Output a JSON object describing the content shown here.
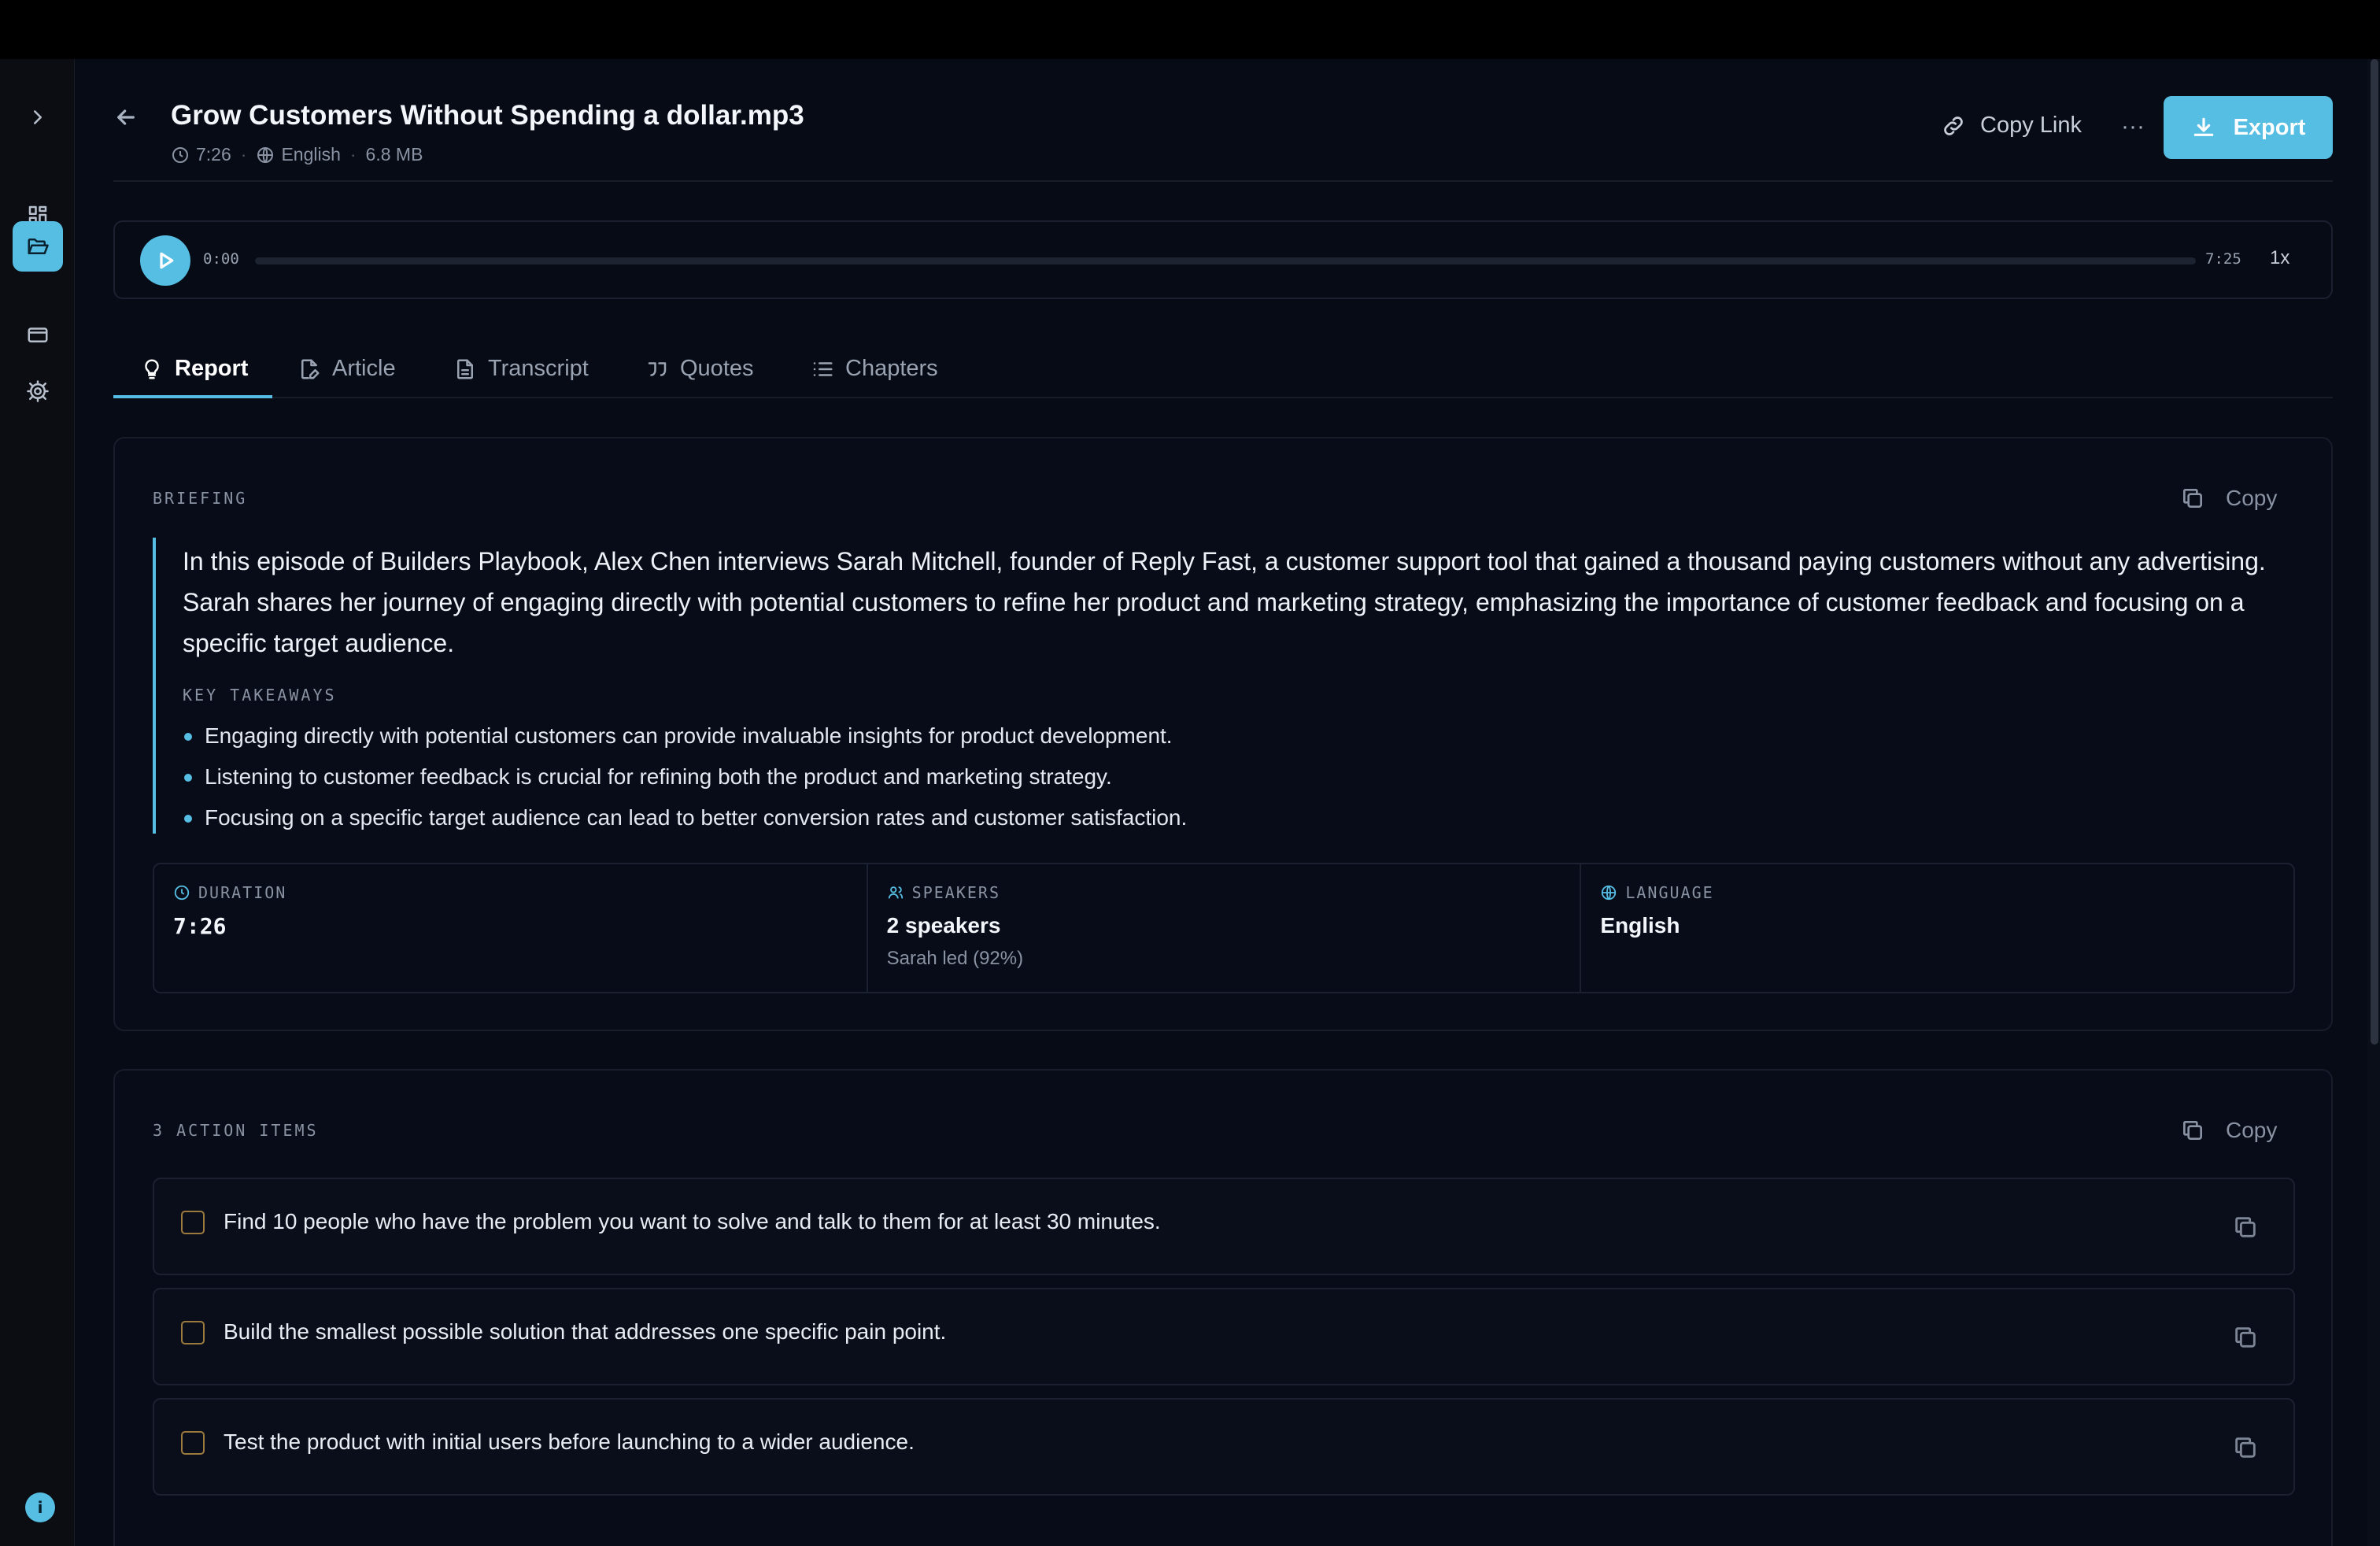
{
  "sidebar": {
    "expand": "chevron-right-icon",
    "items": [
      {
        "name": "dashboard",
        "icon": "grid-icon",
        "active": false
      },
      {
        "name": "library",
        "icon": "folder-open-icon",
        "active": true
      },
      {
        "name": "billing",
        "icon": "credit-card-icon",
        "active": false
      },
      {
        "name": "settings",
        "icon": "gear-icon",
        "active": false
      }
    ],
    "info_badge": "i"
  },
  "header": {
    "title": "Grow Customers Without Spending a dollar.mp3",
    "duration": "7:26",
    "language": "English",
    "size": "6.8 MB",
    "separator": "·",
    "copy_link_label": "Copy Link",
    "more_label": "···",
    "export_label": "Export"
  },
  "player": {
    "current_time": "0:00",
    "total_time": "7:25",
    "progress": 0,
    "speed": "1x"
  },
  "tabs": [
    {
      "label": "Report",
      "icon": "lightbulb-icon",
      "active": true
    },
    {
      "label": "Article",
      "icon": "file-pen-icon",
      "active": false
    },
    {
      "label": "Transcript",
      "icon": "document-icon",
      "active": false
    },
    {
      "label": "Quotes",
      "icon": "quote-icon",
      "active": false
    },
    {
      "label": "Chapters",
      "icon": "list-icon",
      "active": false
    }
  ],
  "briefing": {
    "label": "BRIEFING",
    "copy_label": "Copy",
    "text": "In this episode of Builders Playbook, Alex Chen interviews Sarah Mitchell, founder of Reply Fast, a customer support tool that gained a thousand paying customers without any advertising. Sarah shares her journey of engaging directly with potential customers to refine her product and marketing strategy, emphasizing the importance of customer feedback and focusing on a specific target audience.",
    "key_takeaways_label": "KEY TAKEAWAYS",
    "takeaways": [
      "Engaging directly with potential customers can provide invaluable insights for product development.",
      "Listening to customer feedback is crucial for refining both the product and marketing strategy.",
      "Focusing on a specific target audience can lead to better conversion rates and customer satisfaction."
    ],
    "stats": {
      "duration_label": "DURATION",
      "duration_value": "7:26",
      "speakers_label": "SPEAKERS",
      "speakers_value": "2 speakers",
      "speakers_sub": "Sarah led (92%)",
      "language_label": "LANGUAGE",
      "language_value": "English"
    }
  },
  "actions": {
    "label": "3 ACTION ITEMS",
    "copy_label": "Copy",
    "items": [
      {
        "text": "Find 10 people who have the problem you want to solve and talk to them for at least 30 minutes.",
        "checked": false
      },
      {
        "text": "Build the smallest possible solution that addresses one specific pain point.",
        "checked": false
      },
      {
        "text": "Test the product with initial users before launching to a wider audience.",
        "checked": false
      }
    ]
  },
  "colors": {
    "accent": "#56bde3",
    "background": "#070b16",
    "sidebar": "#0b0d12",
    "checkbox_border": "#9c7a3e"
  }
}
